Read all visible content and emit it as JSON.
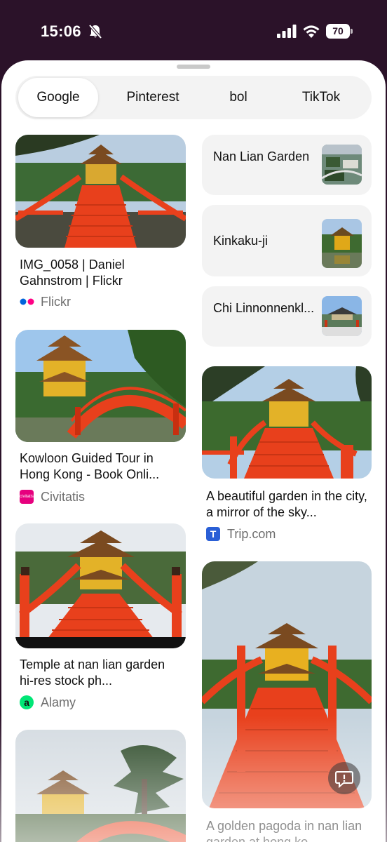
{
  "status_bar": {
    "time": "15:06",
    "battery": "70",
    "icons": [
      "bell-muted-icon",
      "cellular-signal-icon",
      "wifi-icon",
      "battery-icon"
    ]
  },
  "tabs": [
    {
      "label": "Google",
      "active": true
    },
    {
      "label": "Pinterest",
      "active": false
    },
    {
      "label": "bol",
      "active": false
    },
    {
      "label": "TikTok",
      "active": false
    }
  ],
  "related": [
    {
      "label": "Nan Lian Garden"
    },
    {
      "label": "Kinkaku-ji"
    },
    {
      "label": "Chi Linnonnenkl..."
    }
  ],
  "results": [
    {
      "title": "IMG_0058 | Daniel Gahnstrom | Flickr",
      "source": "Flickr"
    },
    {
      "title": "Kowloon Guided Tour in Hong Kong - Book Onli...",
      "source": "Civitatis"
    },
    {
      "title": "Temple at nan lian garden hi-res stock ph...",
      "source": "Alamy"
    },
    {
      "title": "A beautiful garden in the city, a mirror of the sky...",
      "source": "Trip.com"
    },
    {
      "title": "A golden pagoda in nan lian garden at hong ko...",
      "source": ""
    }
  ],
  "source_icons": {
    "civitatis": "civitatis",
    "alamy": "a",
    "trip": "T"
  },
  "colors": {
    "status_bg": "#2b1229",
    "bridge_red": "#e8401c",
    "pagoda_gold": "#e8b020",
    "flickr_blue": "#0063dc",
    "flickr_pink": "#ff0084",
    "civitatis_pink": "#e6007e",
    "alamy_green": "#00e676",
    "trip_blue": "#2a5fd6"
  }
}
